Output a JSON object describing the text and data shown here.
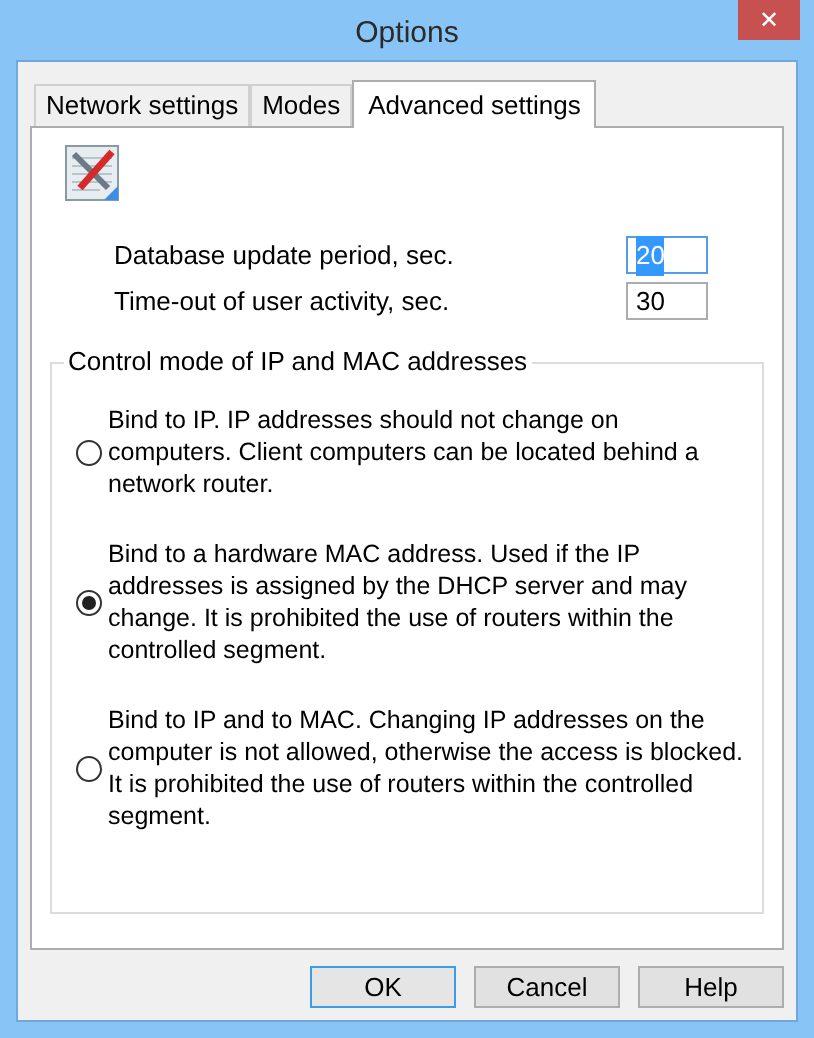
{
  "window": {
    "title": "Options",
    "close": "✕"
  },
  "tabs": [
    {
      "label": "Network settings",
      "selected": false
    },
    {
      "label": "Modes",
      "selected": false
    },
    {
      "label": "Advanced settings",
      "selected": true
    }
  ],
  "fields": [
    {
      "label": "Database update period, sec.",
      "value": "20",
      "focused": true
    },
    {
      "label": "Time-out of user activity, sec.",
      "value": "30",
      "focused": false
    }
  ],
  "group": {
    "title": "Control mode of IP and MAC addresses",
    "options": [
      {
        "label": "Bind to IP. IP addresses should not change on computers. Client computers can be located behind a network router.",
        "selected": false
      },
      {
        "label": "Bind to a hardware MAC address. Used if the IP addresses is assigned by the DHCP server and may change. It is prohibited the use of routers within the controlled segment.",
        "selected": true
      },
      {
        "label": "Bind to IP and to MAC. Changing IP addresses on the computer is not allowed, otherwise the access is blocked. It is prohibited the use of routers within the controlled segment.",
        "selected": false
      }
    ]
  },
  "buttons": [
    {
      "label": "OK",
      "default": true
    },
    {
      "label": "Cancel",
      "default": false
    },
    {
      "label": "Help",
      "default": false
    }
  ]
}
